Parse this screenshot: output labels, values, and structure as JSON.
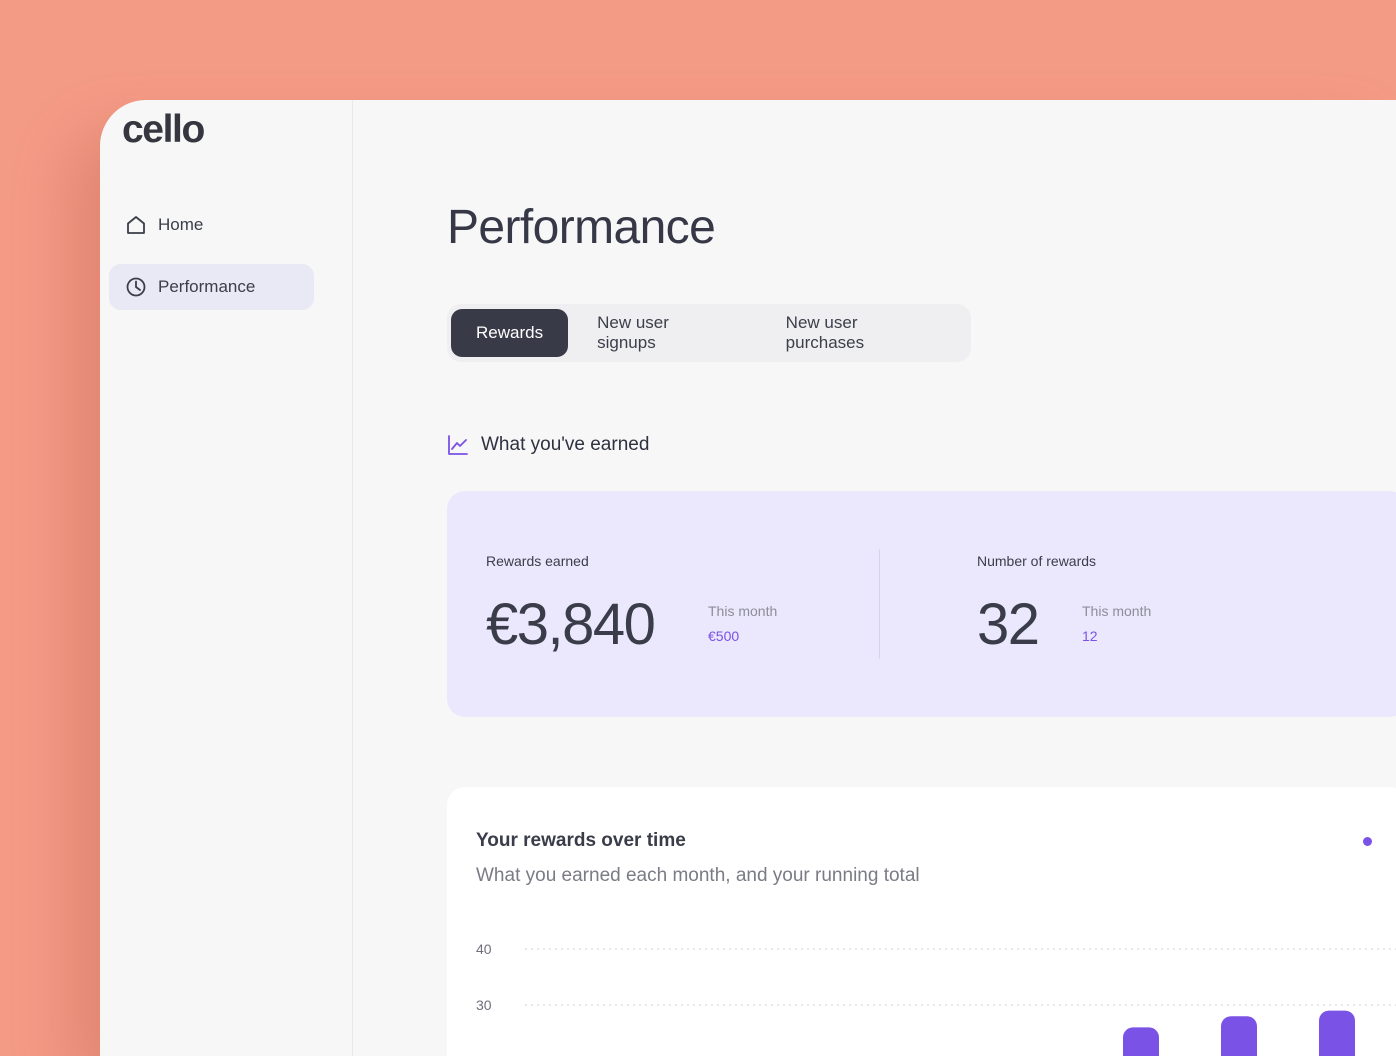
{
  "app": {
    "logo_text": "cello"
  },
  "sidebar": {
    "items": [
      {
        "label": "Home",
        "icon": "home-icon",
        "active": false
      },
      {
        "label": "Performance",
        "icon": "pie-chart-icon",
        "active": true
      }
    ]
  },
  "page": {
    "title": "Performance"
  },
  "tabs": [
    {
      "label": "Rewards",
      "active": true
    },
    {
      "label": "New user signups",
      "active": false
    },
    {
      "label": "New user purchases",
      "active": false
    }
  ],
  "earned_section": {
    "heading": "What you've earned",
    "icon": "line-chart-icon",
    "rewards_earned": {
      "label": "Rewards earned",
      "value": "€3,840",
      "sub_label": "This month",
      "sub_value": "€500"
    },
    "number_of_rewards": {
      "label": "Number of rewards",
      "value": "32",
      "sub_label": "This month",
      "sub_value": "12"
    }
  },
  "colors": {
    "accent": "#7a52e6",
    "background": "#f49b86",
    "panel": "#f6f7f6",
    "stats_bg": "#ebe7fd",
    "active_tab": "#383b47"
  },
  "chart_data": {
    "type": "bar",
    "title": "Your rewards over time",
    "subtitle": "What you earned each month, and your running total",
    "y_ticks": [
      40,
      30
    ],
    "grid": true,
    "legend": "top-right",
    "series": [
      {
        "values": [
          null,
          null,
          null,
          null,
          null,
          null,
          26,
          28,
          29
        ]
      }
    ],
    "bar_color": "#7a52e6"
  }
}
